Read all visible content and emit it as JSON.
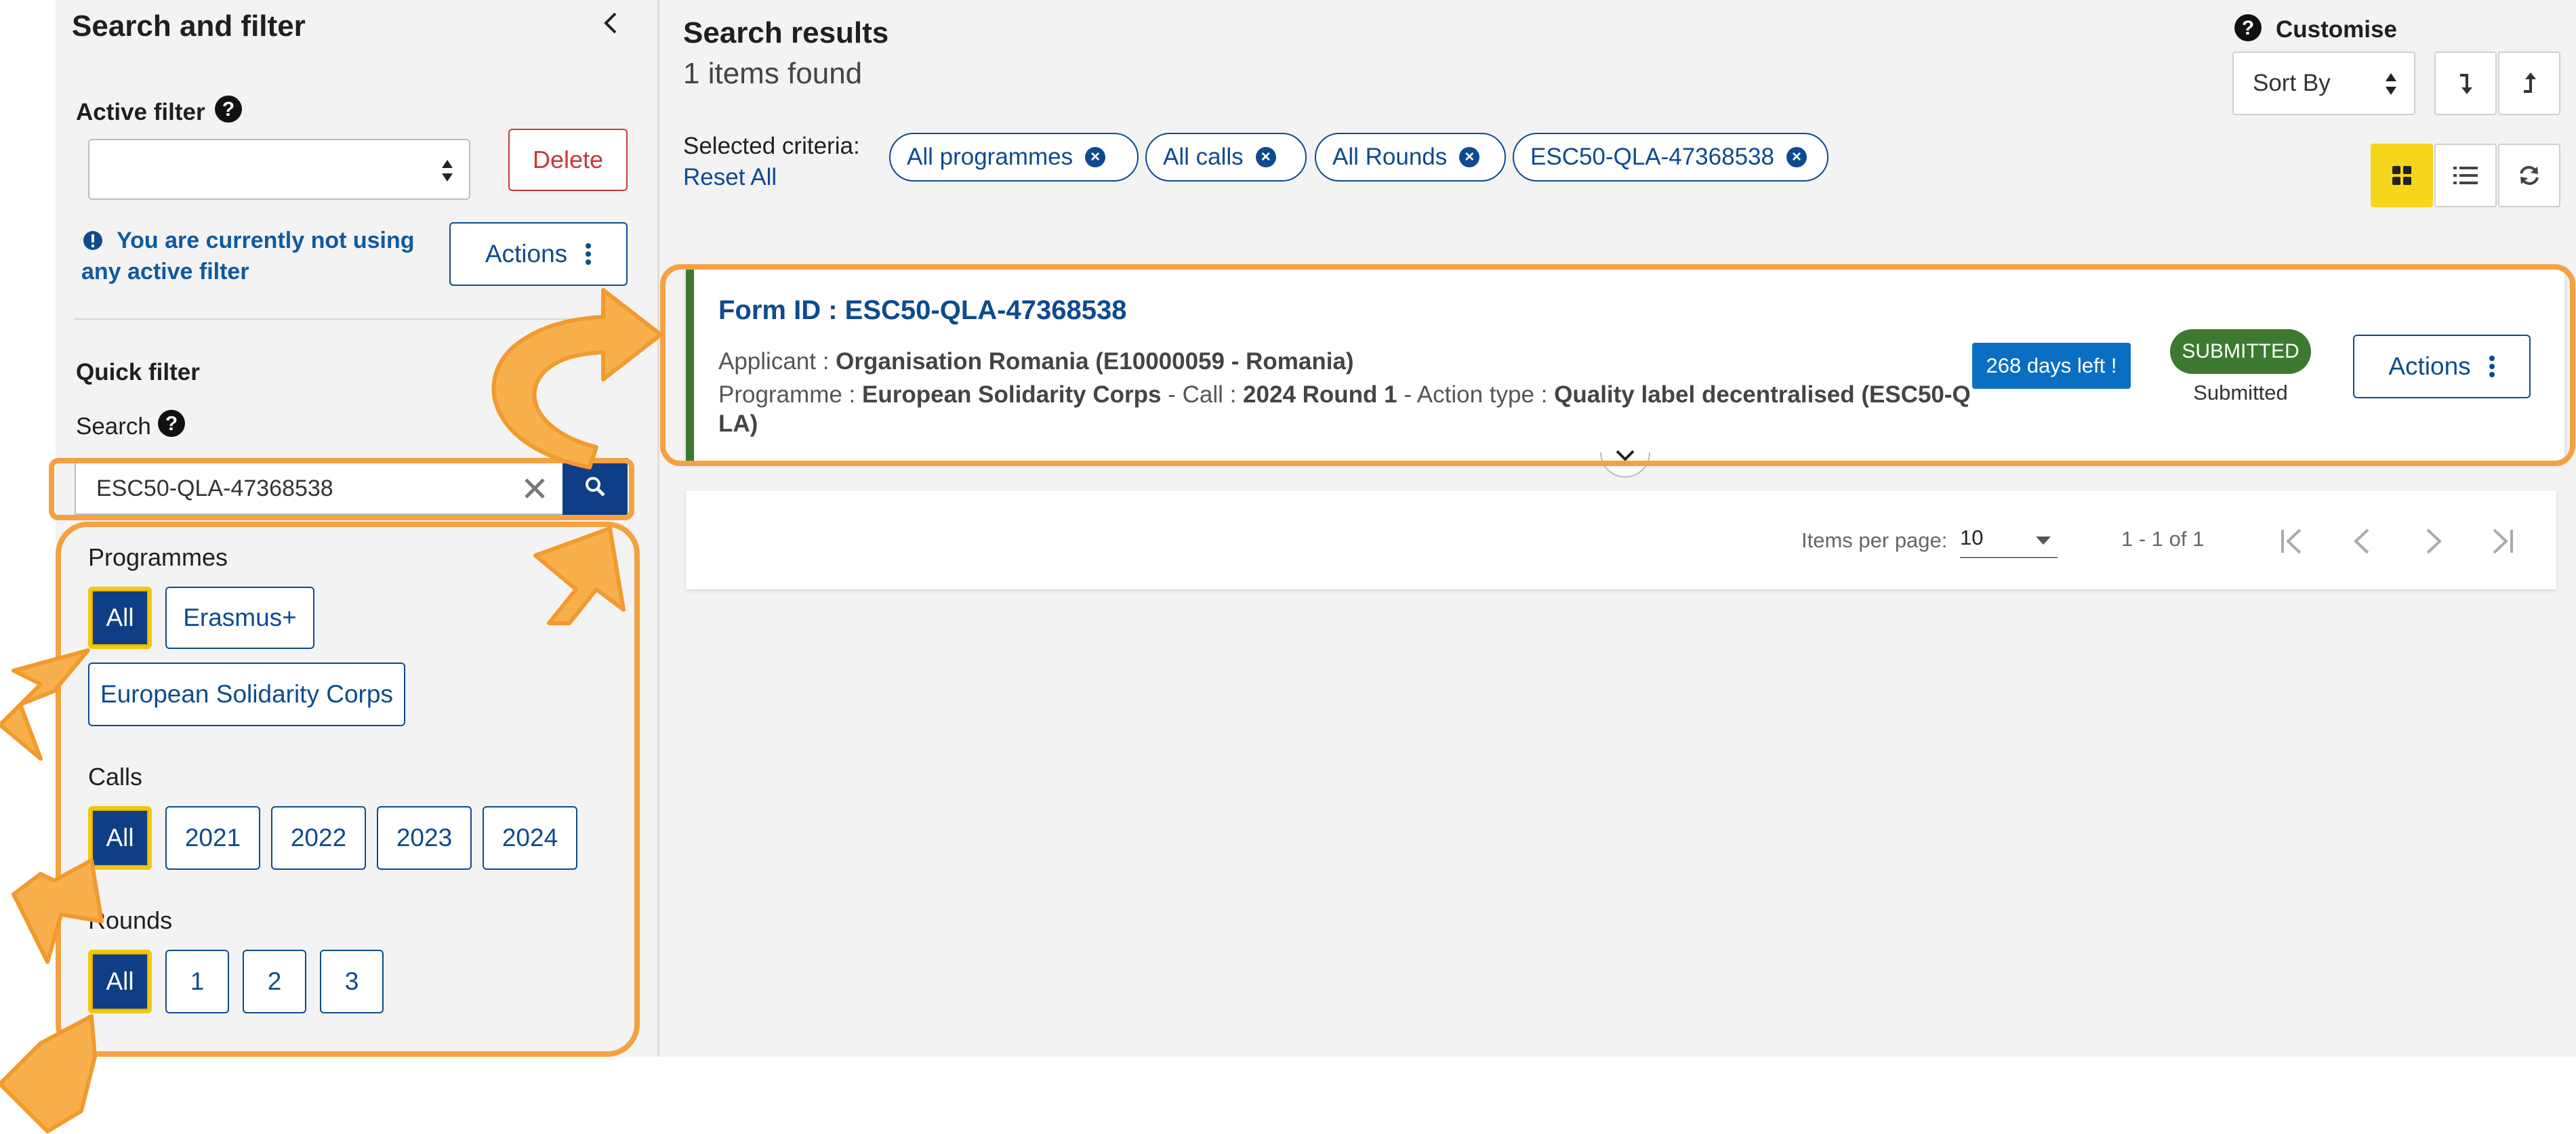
{
  "sidebar": {
    "title": "Search and filter",
    "active_filter_label": "Active filter",
    "delete_label": "Delete",
    "notice": "You are currently not using any active filter",
    "actions_label": "Actions",
    "quick_filter_label": "Quick filter",
    "search_label": "Search",
    "search_value": "ESC50-QLA-47368538",
    "programmes": {
      "label": "Programmes",
      "options": [
        "All",
        "Erasmus+",
        "European Solidarity Corps"
      ],
      "selected": "All"
    },
    "calls": {
      "label": "Calls",
      "options": [
        "All",
        "2021",
        "2022",
        "2023",
        "2024"
      ],
      "selected": "All"
    },
    "rounds": {
      "label": "Rounds",
      "options": [
        "All",
        "1",
        "2",
        "3"
      ],
      "selected": "All"
    }
  },
  "main": {
    "title": "Search results",
    "count_text": "1 items found",
    "customise_label": "Customise",
    "sort_by": "Sort By",
    "selected_criteria_label": "Selected criteria:",
    "reset_all": "Reset All",
    "criteria": [
      "All programmes",
      "All calls",
      "All Rounds",
      "ESC50-QLA-47368538"
    ],
    "result": {
      "form_id": "Form ID : ESC50-QLA-47368538",
      "applicant_label": "Applicant : ",
      "applicant_value": "Organisation Romania (E10000059 - Romania)",
      "programme_label": "Programme : ",
      "programme_value": "European Solidarity Corps",
      "call_label": " - Call : ",
      "call_value": "2024 Round 1",
      "action_type_label": " - Action type : ",
      "action_type_value": "Quality label decentralised (ESC50-Q",
      "action_type_value_cont": "LA)",
      "days_left": "268 days left !",
      "status_badge": "SUBMITTED",
      "status_text": "Submitted",
      "actions_label": "Actions"
    },
    "pagination": {
      "items_per_page_label": "Items per page:",
      "items_per_page_value": "10",
      "range_text": "1 - 1 of 1"
    }
  },
  "colors": {
    "primary": "#0e3e86",
    "highlight_yellow": "#f2c80f",
    "annotation_orange": "#f5a142",
    "status_green": "#3c7a2f",
    "badge_blue": "#0a6fc2",
    "delete_red": "#c73a3a"
  },
  "icons": [
    "chevron-left-icon",
    "help-icon",
    "sort-arrows-icon",
    "info-icon",
    "kebab-icon",
    "clear-icon",
    "search-icon",
    "sort-desc-icon",
    "sort-asc-icon",
    "grid-view-icon",
    "list-view-icon",
    "refresh-icon",
    "chevron-down-icon",
    "first-page-icon",
    "prev-page-icon",
    "next-page-icon",
    "last-page-icon",
    "annotation-arrow-icon"
  ]
}
